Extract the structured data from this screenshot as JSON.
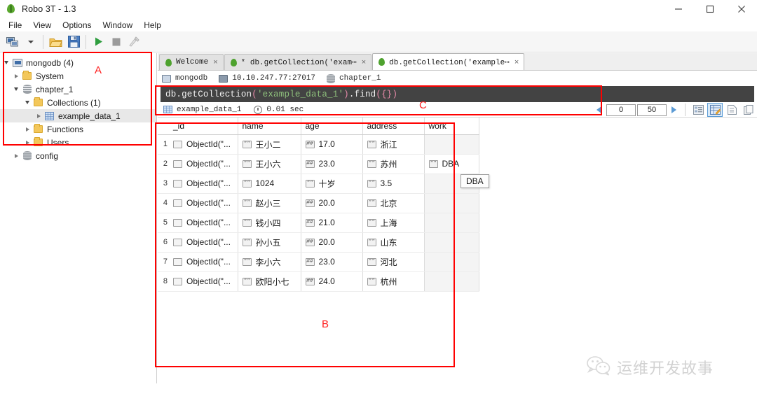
{
  "window": {
    "title": "Robo 3T - 1.3",
    "app_icon": "leaf-icon",
    "minimize": "minimize-icon",
    "maximize": "maximize-icon",
    "close": "close-icon"
  },
  "menubar": {
    "items": [
      {
        "label": "File"
      },
      {
        "label": "View"
      },
      {
        "label": "Options"
      },
      {
        "label": "Window"
      },
      {
        "label": "Help"
      }
    ]
  },
  "toolbar": {
    "buttons": [
      {
        "name": "connect-icon",
        "label": ""
      },
      {
        "name": "connect-dropdown-icon",
        "label": ""
      },
      {
        "name": "open-folder-icon",
        "label": ""
      },
      {
        "name": "save-icon",
        "label": ""
      },
      {
        "name": "execute-icon",
        "label": ""
      },
      {
        "name": "stop-icon",
        "label": ""
      },
      {
        "name": "explain-icon",
        "label": ""
      }
    ]
  },
  "sidebar": {
    "tree": [
      {
        "label": "mongodb (4)",
        "icon": "server-icon",
        "indent": 0,
        "twisty": "down",
        "selected": false
      },
      {
        "label": "System",
        "icon": "folder-icon",
        "indent": 1,
        "twisty": "right",
        "selected": false
      },
      {
        "label": "chapter_1",
        "icon": "database-icon",
        "indent": 1,
        "twisty": "down",
        "selected": false
      },
      {
        "label": "Collections (1)",
        "icon": "folder-icon",
        "indent": 2,
        "twisty": "down",
        "selected": false
      },
      {
        "label": "example_data_1",
        "icon": "collection-grid-icon",
        "indent": 3,
        "twisty": "right",
        "selected": true
      },
      {
        "label": "Functions",
        "icon": "folder-icon",
        "indent": 2,
        "twisty": "right",
        "selected": false
      },
      {
        "label": "Users",
        "icon": "folder-icon",
        "indent": 2,
        "twisty": "right",
        "selected": false
      },
      {
        "label": "config",
        "icon": "database-icon",
        "indent": 1,
        "twisty": "right",
        "selected": false
      }
    ]
  },
  "tabs": [
    {
      "label": "Welcome",
      "active": false,
      "modified": false,
      "close": "×"
    },
    {
      "label": "* db.getCollection('exam⋯",
      "active": false,
      "modified": true,
      "close": "×"
    },
    {
      "label": "db.getCollection('example⋯",
      "active": true,
      "modified": false,
      "close": "×"
    }
  ],
  "connection": {
    "server_name": "mongodb",
    "host": "10.10.247.77:27017",
    "database": "chapter_1"
  },
  "query": {
    "full_text": "db.getCollection('example_data_1').find({})",
    "segments": [
      {
        "text": "db.getCollection",
        "kind": "plain"
      },
      {
        "text": "(",
        "kind": "punct"
      },
      {
        "text": "'example_data_1'",
        "kind": "string"
      },
      {
        "text": ")",
        "kind": "punct"
      },
      {
        "text": ".find",
        "kind": "plain"
      },
      {
        "text": "(",
        "kind": "punct"
      },
      {
        "text": "{}",
        "kind": "punct"
      },
      {
        "text": ")",
        "kind": "punct"
      }
    ]
  },
  "results": {
    "collection_label": "example_data_1",
    "duration": "0.01 sec",
    "paging": {
      "skip": "0",
      "limit": "50",
      "prev_icon": "arrow-left-icon",
      "next_icon": "arrow-right-icon"
    },
    "view_modes": [
      {
        "name": "tree-view-icon",
        "active": false
      },
      {
        "name": "table-view-icon",
        "active": true
      },
      {
        "name": "text-view-icon",
        "active": false
      },
      {
        "name": "copy-icon",
        "active": false
      }
    ]
  },
  "table": {
    "columns": [
      "_id",
      "name",
      "age",
      "address",
      "work"
    ],
    "rows": [
      {
        "num": "1",
        "_id": "ObjectId(\"...",
        "_id_type": "blank",
        "name": "王小二",
        "name_type": "str",
        "age": "17.0",
        "age_type": "num",
        "address": "浙江",
        "address_type": "str",
        "work": "",
        "work_type": "none"
      },
      {
        "num": "2",
        "_id": "ObjectId(\"...",
        "_id_type": "blank",
        "name": "王小六",
        "name_type": "str",
        "age": "23.0",
        "age_type": "num",
        "address": "苏州",
        "address_type": "str",
        "work": "DBA",
        "work_type": "str"
      },
      {
        "num": "3",
        "_id": "ObjectId(\"...",
        "_id_type": "blank",
        "name": "1024",
        "name_type": "str",
        "age": "十岁",
        "age_type": "str",
        "address": "3.5",
        "address_type": "str",
        "work": "",
        "work_type": "none"
      },
      {
        "num": "4",
        "_id": "ObjectId(\"...",
        "_id_type": "blank",
        "name": "赵小三",
        "name_type": "str",
        "age": "20.0",
        "age_type": "num",
        "address": "北京",
        "address_type": "str",
        "work": "",
        "work_type": "none"
      },
      {
        "num": "5",
        "_id": "ObjectId(\"...",
        "_id_type": "blank",
        "name": "钱小四",
        "name_type": "str",
        "age": "21.0",
        "age_type": "num",
        "address": "上海",
        "address_type": "str",
        "work": "",
        "work_type": "none"
      },
      {
        "num": "6",
        "_id": "ObjectId(\"...",
        "_id_type": "blank",
        "name": "孙小五",
        "name_type": "str",
        "age": "20.0",
        "age_type": "num",
        "address": "山东",
        "address_type": "str",
        "work": "",
        "work_type": "none"
      },
      {
        "num": "7",
        "_id": "ObjectId(\"...",
        "_id_type": "blank",
        "name": "李小六",
        "name_type": "str",
        "age": "23.0",
        "age_type": "num",
        "address": "河北",
        "address_type": "str",
        "work": "",
        "work_type": "none"
      },
      {
        "num": "8",
        "_id": "ObjectId(\"...",
        "_id_type": "blank",
        "name": "欧阳小七",
        "name_type": "str",
        "age": "24.0",
        "age_type": "num",
        "address": "杭州",
        "address_type": "str",
        "work": "",
        "work_type": "none"
      }
    ]
  },
  "tooltip": {
    "text": "DBA"
  },
  "annotations": [
    {
      "label": "A"
    },
    {
      "label": "B"
    },
    {
      "label": "C"
    }
  ],
  "watermark": {
    "text": "运维开发故事",
    "logo": "wechat-icon"
  },
  "colors": {
    "accent": "#ff0000",
    "editor_bg": "#434343",
    "string": "#8ec07c",
    "punct": "#e58aa8",
    "selected_tab": "#ffffff"
  }
}
